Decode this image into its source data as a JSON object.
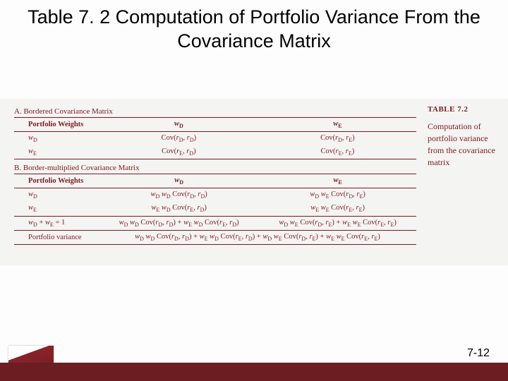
{
  "title": "Table 7. 2 Computation of Portfolio Variance From the Covariance Matrix",
  "sidebar": {
    "label": "TABLE 7.2",
    "caption": "Computation of portfolio variance from the covariance matrix"
  },
  "sectionA": {
    "heading": "A. Bordered Covariance Matrix",
    "headerLabel": "Portfolio Weights",
    "col1": "w_D",
    "col2": "w_E",
    "rows": [
      {
        "label": "w_D",
        "c1": "Cov(r_D, r_D)",
        "c2": "Cov(r_D, r_E)"
      },
      {
        "label": "w_E",
        "c1": "Cov(r_E, r_D)",
        "c2": "Cov(r_E, r_E)"
      }
    ]
  },
  "sectionB": {
    "heading": "B. Border-multiplied Covariance Matrix",
    "headerLabel": "Portfolio Weights",
    "col1": "w_D",
    "col2": "w_E",
    "rows": [
      {
        "label": "w_D",
        "c1": "w_D w_D Cov(r_D, r_D)",
        "c2": "w_D w_E Cov(r_D, r_E)"
      },
      {
        "label": "w_E",
        "c1": "w_E w_D Cov(r_E, r_D)",
        "c2": "w_E w_E Cov(r_E, r_E)"
      }
    ],
    "sumRow": {
      "label": "w_D + w_E = 1",
      "c1": "w_D w_D Cov(r_D, r_D) + w_E w_D Cov(r_E, r_D)",
      "c2": "w_D w_E Cov(r_D, r_E) + w_E w_E Cov(r_E, r_E)"
    },
    "varRow": {
      "label": "Portfolio variance",
      "full": "w_D w_D Cov(r_D, r_D) + w_E w_D Cov(r_E, r_D) + w_D w_E Cov(r_D, r_E) + w_E w_E Cov(r_E, r_E)"
    }
  },
  "pageNumber": "7-12",
  "chart_data": {
    "type": "table",
    "title": "Table 7.2 Computation of Portfolio Variance From the Covariance Matrix",
    "panels": [
      {
        "name": "A. Bordered Covariance Matrix",
        "row_labels": [
          "w_D",
          "w_E"
        ],
        "col_labels": [
          "w_D",
          "w_E"
        ],
        "cells": [
          [
            "Cov(r_D, r_D)",
            "Cov(r_D, r_E)"
          ],
          [
            "Cov(r_E, r_D)",
            "Cov(r_E, r_E)"
          ]
        ]
      },
      {
        "name": "B. Border-multiplied Covariance Matrix",
        "row_labels": [
          "w_D",
          "w_E"
        ],
        "col_labels": [
          "w_D",
          "w_E"
        ],
        "cells": [
          [
            "w_D w_D Cov(r_D, r_D)",
            "w_D w_E Cov(r_D, r_E)"
          ],
          [
            "w_E w_D Cov(r_E, r_D)",
            "w_E w_E Cov(r_E, r_E)"
          ]
        ],
        "summary_rows": [
          {
            "label": "w_D + w_E = 1",
            "cells": [
              "w_D w_D Cov(r_D, r_D) + w_E w_D Cov(r_E, r_D)",
              "w_D w_E Cov(r_D, r_E) + w_E w_E Cov(r_E, r_E)"
            ]
          },
          {
            "label": "Portfolio variance",
            "full": "w_D w_D Cov(r_D, r_D) + w_E w_D Cov(r_E, r_D) + w_D w_E Cov(r_D, r_E) + w_E w_E Cov(r_E, r_E)"
          }
        ]
      }
    ]
  }
}
